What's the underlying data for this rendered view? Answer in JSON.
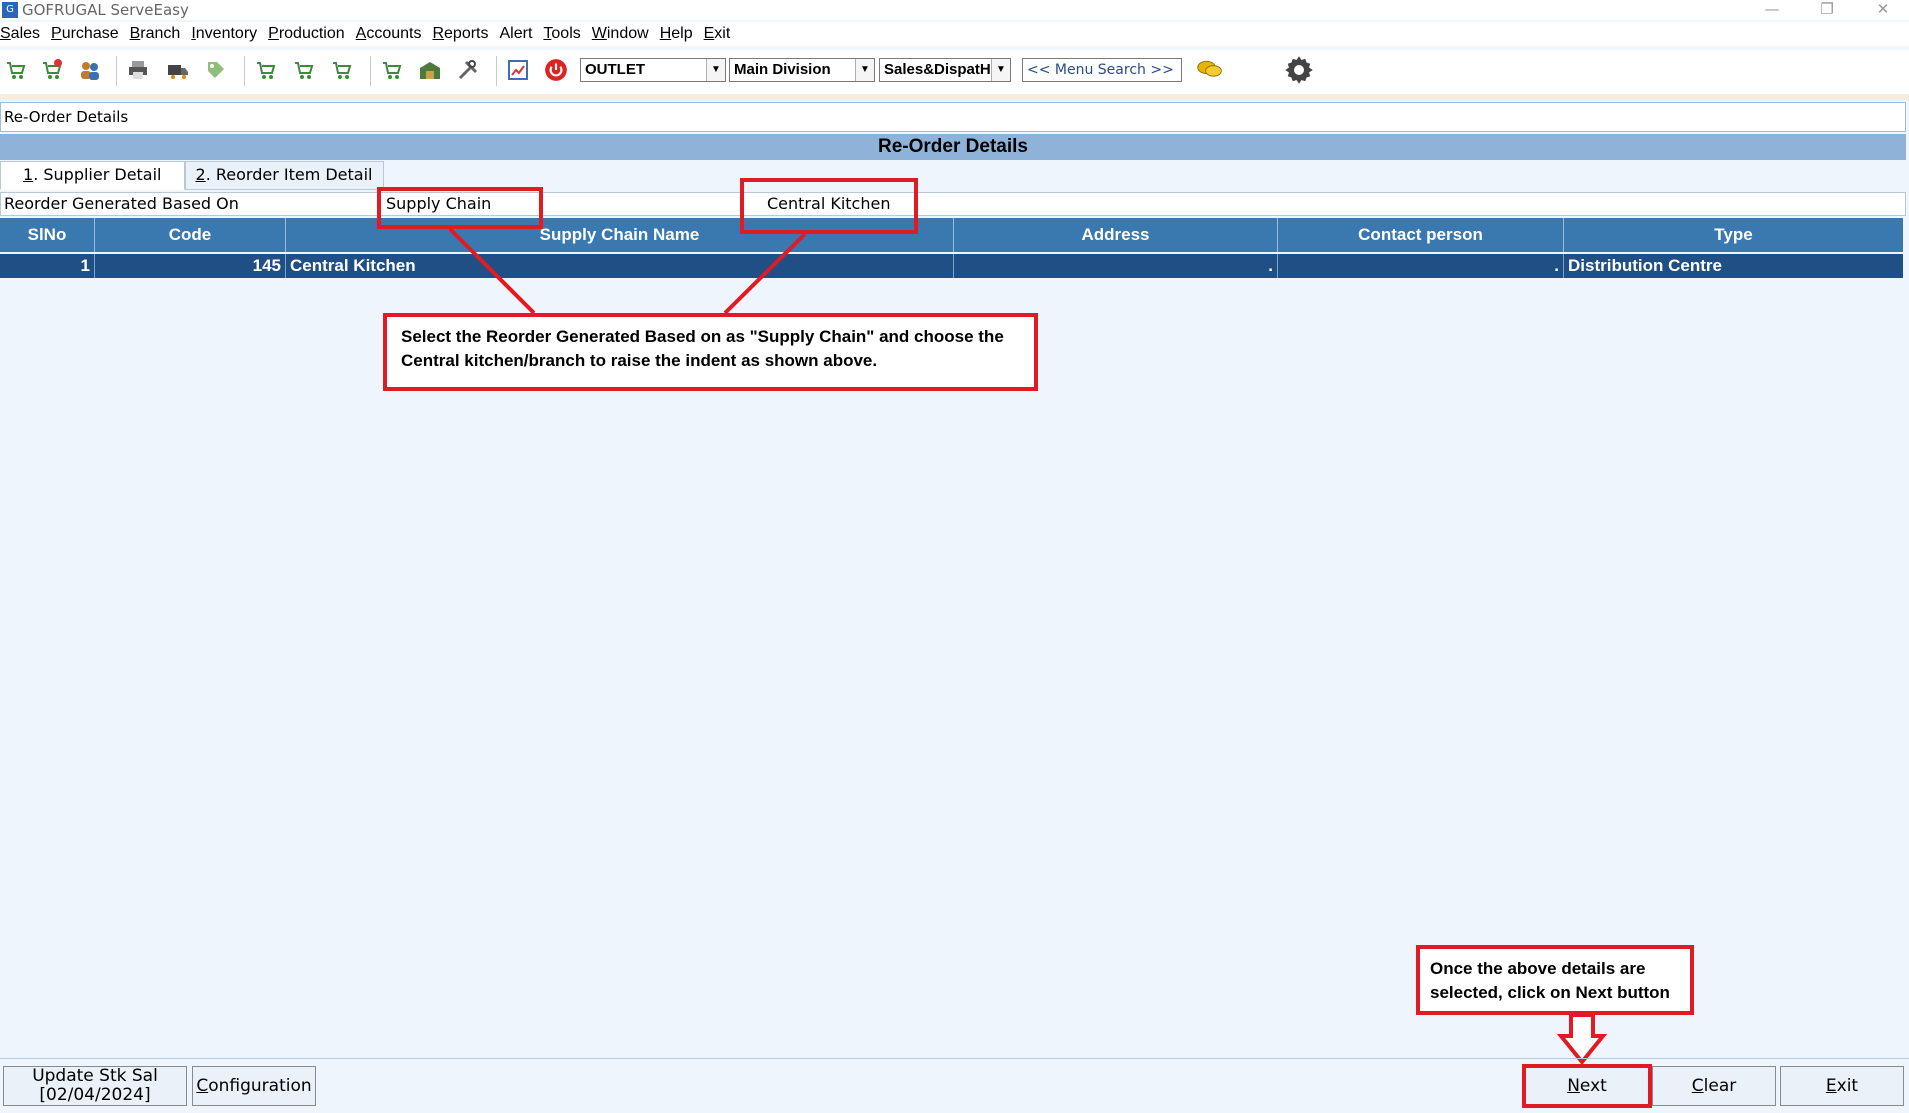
{
  "window": {
    "title": "GOFRUGAL ServeEasy",
    "app_icon_glyph": "G",
    "controls": [
      "—",
      "❐",
      "✕"
    ]
  },
  "menu": [
    {
      "hot": "S",
      "rest": "ales"
    },
    {
      "hot": "P",
      "rest": "urchase"
    },
    {
      "hot": "B",
      "rest": "ranch"
    },
    {
      "hot": "I",
      "rest": "nventory"
    },
    {
      "hot": "P",
      "rest": "roduction"
    },
    {
      "hot": "A",
      "rest": "ccounts"
    },
    {
      "hot": "R",
      "rest": "eports"
    },
    {
      "hot": "",
      "rest": "Alert"
    },
    {
      "hot": "T",
      "rest": "ools"
    },
    {
      "hot": "W",
      "rest": "indow"
    },
    {
      "hot": "H",
      "rest": "elp"
    },
    {
      "hot": "E",
      "rest": "xit"
    }
  ],
  "toolbar": {
    "combos": {
      "outlet": "OUTLET",
      "division": "Main Division",
      "sales": "Sales&DispatHI"
    },
    "menu_search": "<< Menu Search >>",
    "icons": [
      "cart-icon",
      "cart-add-icon",
      "users-icon",
      "printer-icon",
      "truck-icon",
      "tag-icon",
      "cart-in-icon",
      "cart-out-icon",
      "cart-return-icon",
      "cart-transfer-icon",
      "warehouse-icon",
      "tools-icon",
      "chart-icon",
      "power-icon",
      "chat-icon",
      "gear-icon"
    ]
  },
  "panel": {
    "caption": "Re-Order Details",
    "header": "Re-Order Details",
    "tabs": [
      {
        "hot": "1",
        "rest": ". Supplier Detail"
      },
      {
        "hot": "2",
        "rest": ". Reorder Item Detail"
      }
    ],
    "filter": {
      "label": "Reorder Generated Based On",
      "based_on": "Supply Chain",
      "supply_chain": "Central Kitchen"
    }
  },
  "grid": {
    "columns": [
      "SlNo",
      "Code",
      "Supply Chain Name",
      "Address",
      "Contact person",
      "Type"
    ],
    "rows": [
      {
        "slno": "1",
        "code": "145",
        "name": "Central Kitchen",
        "address": ".",
        "contact": ".",
        "type": "Distribution Centre"
      }
    ]
  },
  "annotations": {
    "callout1": "Select the Reorder Generated Based on as \"Supply Chain\" and choose the Central kitchen/branch to raise the indent as shown above.",
    "callout2": "Once the above details are selected, click on Next button"
  },
  "buttons": {
    "update_stk": "Update Stk Sal",
    "update_date": "[02/04/2024]",
    "configuration": {
      "hot": "C",
      "rest": "onfiguration"
    },
    "next": {
      "hot": "N",
      "rest": "ext"
    },
    "clear": {
      "hot": "C",
      "rest": "lear"
    },
    "exit": {
      "hot": "E",
      "rest": "xit"
    }
  },
  "colors": {
    "accent": "#3a78b0",
    "selected_row": "#1f4f84",
    "annotation": "#e01b24"
  }
}
